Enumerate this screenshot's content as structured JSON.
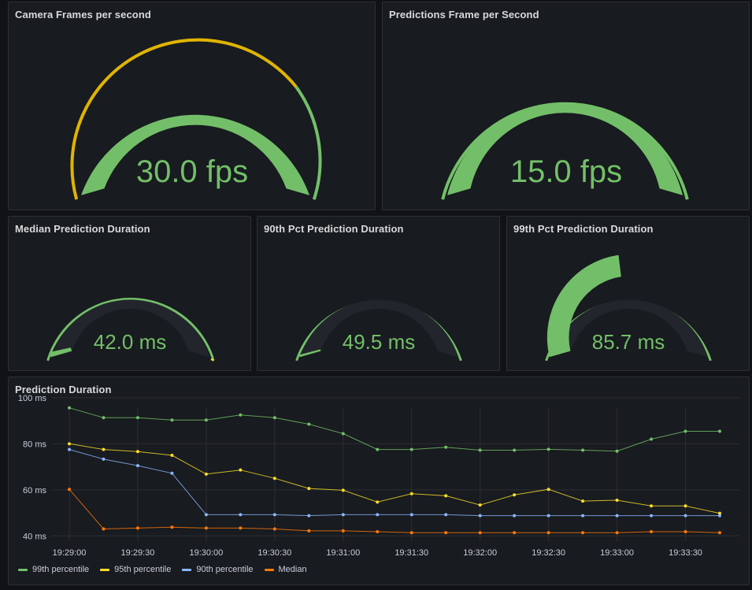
{
  "panels": {
    "camera_fps": {
      "title": "Camera Frames per second",
      "value_text": "30.0 fps",
      "value": 30.0,
      "max": 30.0
    },
    "prediction_fps": {
      "title": "Predictions Frame per Second",
      "value_text": "15.0 fps",
      "value": 15.0,
      "max": 15.0
    },
    "median_duration": {
      "title": "Median Prediction Duration",
      "value_text": "42.0 ms",
      "value_fraction": 0.05
    },
    "p90_duration": {
      "title": "90th Pct Prediction Duration",
      "value_text": "49.5 ms",
      "value_fraction": 0.03
    },
    "p99_duration": {
      "title": "99th Pct Prediction Duration",
      "value_text": "85.7 ms",
      "value_fraction": 0.43
    }
  },
  "colors": {
    "green": "#73bf69",
    "yellow": "#e0b400",
    "blue": "#8ab8ff",
    "orange": "#ff780a",
    "track": "#22252b"
  },
  "timeseries": {
    "title": "Prediction Duration"
  },
  "chart_data": {
    "type": "line",
    "title": "Prediction Duration",
    "x": [
      "19:29:00",
      "19:29:15",
      "19:29:30",
      "19:29:45",
      "19:30:00",
      "19:30:15",
      "19:30:30",
      "19:30:45",
      "19:31:00",
      "19:31:15",
      "19:31:30",
      "19:31:45",
      "19:32:00",
      "19:32:15",
      "19:32:30",
      "19:32:45",
      "19:33:00",
      "19:33:15",
      "19:33:30",
      "19:33:45"
    ],
    "x_ticks": [
      "19:29:00",
      "19:29:30",
      "19:30:00",
      "19:30:30",
      "19:31:00",
      "19:31:30",
      "19:32:00",
      "19:32:30",
      "19:33:00",
      "19:33:30"
    ],
    "y_ticks": [
      "40 ms",
      "60 ms",
      "80 ms",
      "100 ms"
    ],
    "ylim": [
      36,
      102
    ],
    "grid": true,
    "legend": "bottom-left",
    "series": [
      {
        "name": "99th percentile",
        "color": "#73bf69",
        "values": [
          95.6,
          91.3,
          91.3,
          90.3,
          90.3,
          92.5,
          91.3,
          88.5,
          84.4,
          77.5,
          77.5,
          78.5,
          77.2,
          77.2,
          77.6,
          77.2,
          76.8,
          82.0,
          85.4,
          85.4
        ]
      },
      {
        "name": "95th percentile",
        "color": "#fade2a",
        "values": [
          80.0,
          77.5,
          76.6,
          75.0,
          66.8,
          68.6,
          65.0,
          60.6,
          59.8,
          54.7,
          58.3,
          57.4,
          53.4,
          57.8,
          60.2,
          55.1,
          55.5,
          53.0,
          53.0,
          49.8
        ]
      },
      {
        "name": "90th percentile",
        "color": "#8ab8ff",
        "values": [
          77.5,
          73.3,
          70.5,
          67.2,
          49.2,
          49.2,
          49.2,
          48.8,
          49.2,
          49.2,
          49.2,
          49.2,
          48.8,
          48.8,
          48.8,
          48.8,
          48.8,
          48.8,
          48.8,
          48.8
        ]
      },
      {
        "name": "Median",
        "color": "#ff780a",
        "values": [
          60.2,
          43.0,
          43.4,
          43.8,
          43.4,
          43.4,
          43.0,
          42.2,
          42.2,
          41.8,
          41.4,
          41.4,
          41.4,
          41.4,
          41.4,
          41.4,
          41.4,
          41.8,
          41.8,
          41.4
        ]
      }
    ]
  }
}
